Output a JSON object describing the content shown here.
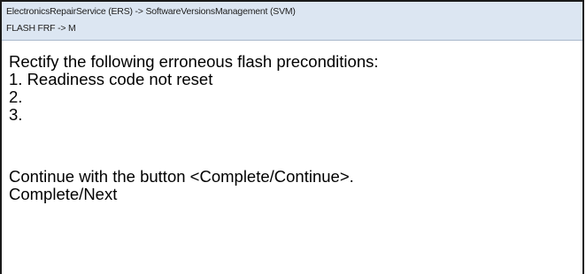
{
  "header": {
    "breadcrumb": "ElectronicsRepairService (ERS) -> SoftwareVersionsManagement (SVM)",
    "subtitle": "FLASH FRF -> M"
  },
  "message": {
    "intro": "Rectify the following erroneous flash preconditions:",
    "items": [
      "1. Readiness code not reset",
      "2.",
      "3."
    ],
    "instruction": "Continue with the button <Complete/Continue>.",
    "action": "Complete/Next"
  }
}
